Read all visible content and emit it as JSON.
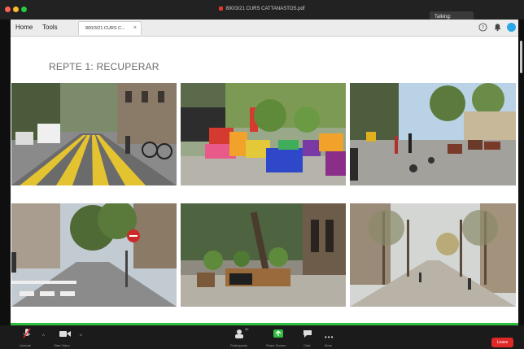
{
  "window": {
    "title": "800/3/21 CURS CATTANASTOS.pdf",
    "talking_label": "Talking:"
  },
  "appbar": {
    "menu": [
      "Home",
      "Tools"
    ],
    "tab_label": "800/3/21 CURS C...",
    "tab_close": "×"
  },
  "document": {
    "heading": "REPTE 1: RECUPERAR",
    "photos": [
      "barcelona-street-yellow-lanes",
      "colourful-block-seating-plaza",
      "superblock-square-people-playing",
      "street-with-stop-sign-trees",
      "tree-planters-sidewalk",
      "tree-lined-boulevard"
    ]
  },
  "zoombar": {
    "unmute_label": "Unmute",
    "video_label": "Start Video",
    "participants_label": "Participants",
    "participants_count": "32",
    "share_label": "Share Screen",
    "chat_label": "Chat",
    "more_label": "More",
    "leave_label": "Leave"
  },
  "colors": {
    "accent_green": "#2fbf3f",
    "leave_red": "#e02828",
    "avatar_blue": "#2aa7e8"
  }
}
